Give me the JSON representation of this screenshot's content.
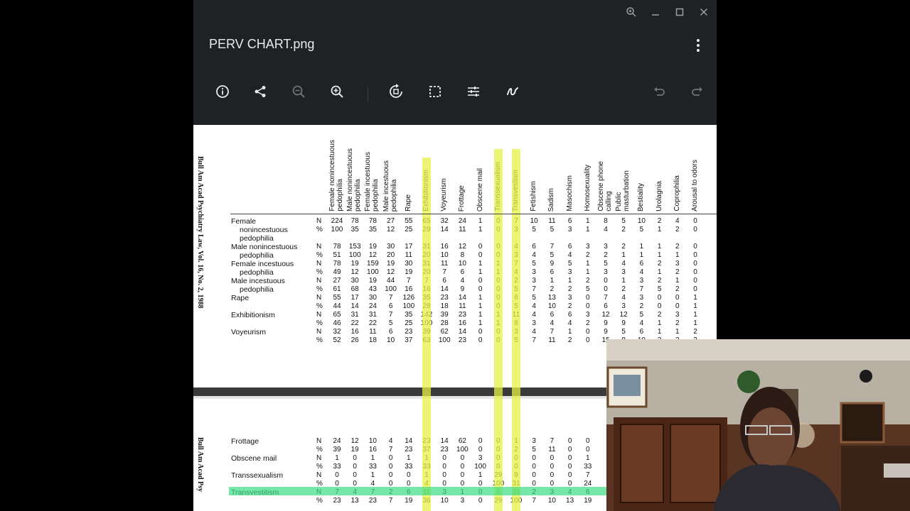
{
  "window": {
    "title": "PERV CHART.png",
    "controls": [
      "zoom-icon",
      "minimize-icon",
      "maximize-icon",
      "close-icon"
    ]
  },
  "toolbar": {
    "tools": [
      {
        "name": "info-icon"
      },
      {
        "name": "share-icon"
      },
      {
        "name": "zoom-out-icon"
      },
      {
        "name": "zoom-in-icon"
      },
      {
        "name": "rotate-icon"
      },
      {
        "name": "crop-icon"
      },
      {
        "name": "adjust-icon"
      },
      {
        "name": "markup-icon"
      },
      {
        "name": "undo-icon"
      },
      {
        "name": "redo-icon"
      }
    ]
  },
  "document": {
    "journal_citation": "Bull Am Acad Psychiatry Law, Vol. 16, No. 2, 1988",
    "journal_citation_bottom": "Bull Am Acad Psy",
    "columns": [
      "Female nonincestuous\npedophilia",
      "Male nonincestuous\npedophilia",
      "Female incestuous\npedophilia",
      "Male incestuous\npedophilia",
      "Rape",
      "Exhibitionism",
      "Voyeurism",
      "Frottage",
      "Obscene mail",
      "Transsexualism",
      "Transvestism",
      "Fetishism",
      "Sadism",
      "Masochism",
      "Homosexuality",
      "Obscene phone\ncalling",
      "Public\nmasturbation",
      "Bestiality",
      "Urolagnia",
      "Coprophilia",
      "Arousal to odors"
    ],
    "top_rows": [
      {
        "labels": [
          "Female",
          "nonincestuous",
          "pedophilia"
        ],
        "type": "N",
        "values": [
          "224",
          "78",
          "78",
          "27",
          "55",
          "65",
          "32",
          "24",
          "1",
          "0",
          "7",
          "10",
          "11",
          "6",
          "1",
          "8",
          "5",
          "10",
          "2",
          "4",
          "0"
        ]
      },
      {
        "labels": [],
        "type": "%",
        "values": [
          "100",
          "35",
          "35",
          "12",
          "25",
          "29",
          "14",
          "11",
          "1",
          "0",
          "3",
          "5",
          "5",
          "3",
          "1",
          "4",
          "2",
          "5",
          "1",
          "2",
          "0"
        ]
      },
      {
        "labels": [
          "Male nonincestuous"
        ],
        "type": "N",
        "values": [
          "78",
          "153",
          "19",
          "30",
          "17",
          "31",
          "16",
          "12",
          "0",
          "0",
          "4",
          "6",
          "7",
          "6",
          "3",
          "3",
          "2",
          "1",
          "1",
          "2",
          "0"
        ]
      },
      {
        "labels": [
          "pedophilia"
        ],
        "type": "%",
        "values": [
          "51",
          "100",
          "12",
          "20",
          "11",
          "20",
          "10",
          "8",
          "0",
          "0",
          "3",
          "4",
          "5",
          "4",
          "2",
          "2",
          "1",
          "1",
          "1",
          "1",
          "0"
        ]
      },
      {
        "labels": [
          "Female incestuous"
        ],
        "type": "N",
        "values": [
          "78",
          "19",
          "159",
          "19",
          "30",
          "31",
          "11",
          "10",
          "1",
          "1",
          "7",
          "5",
          "9",
          "5",
          "1",
          "5",
          "4",
          "6",
          "2",
          "3",
          "0"
        ]
      },
      {
        "labels": [
          "pedophilia"
        ],
        "type": "%",
        "values": [
          "49",
          "12",
          "100",
          "12",
          "19",
          "20",
          "7",
          "6",
          "1",
          "1",
          "4",
          "3",
          "6",
          "3",
          "1",
          "3",
          "3",
          "4",
          "1",
          "2",
          "0"
        ]
      },
      {
        "labels": [
          "Male incestuous"
        ],
        "type": "N",
        "values": [
          "27",
          "30",
          "19",
          "44",
          "7",
          "7",
          "6",
          "4",
          "0",
          "0",
          "2",
          "3",
          "1",
          "1",
          "2",
          "0",
          "1",
          "3",
          "2",
          "1",
          "0"
        ]
      },
      {
        "labels": [
          "pedophilia"
        ],
        "type": "%",
        "values": [
          "61",
          "68",
          "43",
          "100",
          "16",
          "16",
          "14",
          "9",
          "0",
          "0",
          "5",
          "7",
          "2",
          "2",
          "5",
          "0",
          "2",
          "7",
          "5",
          "2",
          "0"
        ]
      },
      {
        "labels": [
          "Rape"
        ],
        "type": "N",
        "values": [
          "55",
          "17",
          "30",
          "7",
          "126",
          "35",
          "23",
          "14",
          "1",
          "0",
          "6",
          "5",
          "13",
          "3",
          "0",
          "7",
          "4",
          "3",
          "0",
          "0",
          "1"
        ]
      },
      {
        "labels": [],
        "type": "%",
        "values": [
          "44",
          "14",
          "24",
          "6",
          "100",
          "28",
          "18",
          "11",
          "1",
          "0",
          "5",
          "4",
          "10",
          "2",
          "0",
          "6",
          "3",
          "2",
          "0",
          "0",
          "1"
        ]
      },
      {
        "labels": [
          "Exhibitionism"
        ],
        "type": "N",
        "values": [
          "65",
          "31",
          "31",
          "7",
          "35",
          "142",
          "39",
          "23",
          "1",
          "1",
          "11",
          "4",
          "6",
          "6",
          "3",
          "12",
          "12",
          "5",
          "2",
          "3",
          "1"
        ]
      },
      {
        "labels": [],
        "type": "%",
        "values": [
          "46",
          "22",
          "22",
          "5",
          "25",
          "100",
          "28",
          "16",
          "1",
          "1",
          "8",
          "3",
          "4",
          "4",
          "2",
          "9",
          "9",
          "4",
          "1",
          "2",
          "1"
        ]
      },
      {
        "labels": [
          "Voyeurism"
        ],
        "type": "N",
        "values": [
          "32",
          "16",
          "11",
          "6",
          "23",
          "39",
          "62",
          "14",
          "0",
          "0",
          "3",
          "4",
          "7",
          "1",
          "0",
          "9",
          "5",
          "6",
          "1",
          "1",
          "2"
        ]
      },
      {
        "labels": [],
        "type": "%",
        "values": [
          "52",
          "26",
          "18",
          "10",
          "37",
          "63",
          "100",
          "23",
          "0",
          "0",
          "5",
          "7",
          "11",
          "2",
          "0",
          "15",
          "8",
          "10",
          "2",
          "2",
          "3"
        ]
      }
    ],
    "bottom_rows": [
      {
        "labels": [
          "Frottage"
        ],
        "type": "N",
        "values": [
          "24",
          "12",
          "10",
          "4",
          "14",
          "23",
          "14",
          "62",
          "0",
          "0",
          "1",
          "3",
          "7",
          "0",
          "0"
        ]
      },
      {
        "labels": [],
        "type": "%",
        "values": [
          "39",
          "19",
          "16",
          "7",
          "23",
          "37",
          "23",
          "100",
          "0",
          "0",
          "2",
          "5",
          "11",
          "0",
          "0"
        ]
      },
      {
        "labels": [
          "Obscene mail"
        ],
        "type": "N",
        "values": [
          "1",
          "0",
          "1",
          "0",
          "1",
          "1",
          "0",
          "0",
          "3",
          "0",
          "0",
          "0",
          "0",
          "0",
          "1"
        ]
      },
      {
        "labels": [],
        "type": "%",
        "values": [
          "33",
          "0",
          "33",
          "0",
          "33",
          "33",
          "0",
          "0",
          "100",
          "0",
          "0",
          "0",
          "0",
          "0",
          "33"
        ]
      },
      {
        "labels": [
          "Transsexualism"
        ],
        "type": "N",
        "values": [
          "0",
          "0",
          "1",
          "0",
          "0",
          "1",
          "0",
          "0",
          "1",
          "29",
          "9",
          "0",
          "0",
          "0",
          "7"
        ]
      },
      {
        "labels": [],
        "type": "%",
        "values": [
          "0",
          "0",
          "4",
          "0",
          "0",
          "4",
          "0",
          "0",
          "0",
          "100",
          "31",
          "0",
          "0",
          "0",
          "24"
        ]
      },
      {
        "labels": [
          "Transvestitism"
        ],
        "type": "N",
        "values": [
          "7",
          "4",
          "7",
          "2",
          "6",
          "11",
          "3",
          "1",
          "0",
          "9",
          "31",
          "2",
          "3",
          "4",
          "6"
        ]
      },
      {
        "labels": [],
        "type": "%",
        "values": [
          "23",
          "13",
          "23",
          "7",
          "19",
          "36",
          "10",
          "3",
          "0",
          "29",
          "100",
          "7",
          "10",
          "13",
          "19"
        ]
      }
    ]
  },
  "colors": {
    "viewer_bg": "#202124",
    "highlight_yellow": "#e6f244",
    "highlight_green": "#3ddc84"
  }
}
